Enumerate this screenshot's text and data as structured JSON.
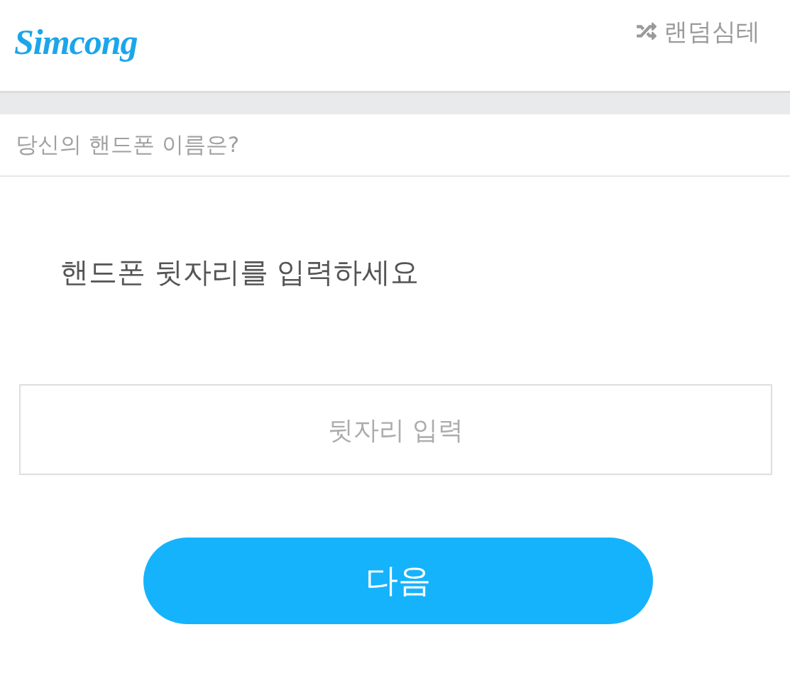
{
  "header": {
    "logo": "Simcong",
    "random_link": {
      "label": "랜덤심테"
    }
  },
  "question": "당신의 핸드폰 이름은?",
  "prompt": "핸드폰 뒷자리를 입력하세요",
  "input": {
    "placeholder": "뒷자리 입력"
  },
  "button": {
    "label": "다음"
  }
}
